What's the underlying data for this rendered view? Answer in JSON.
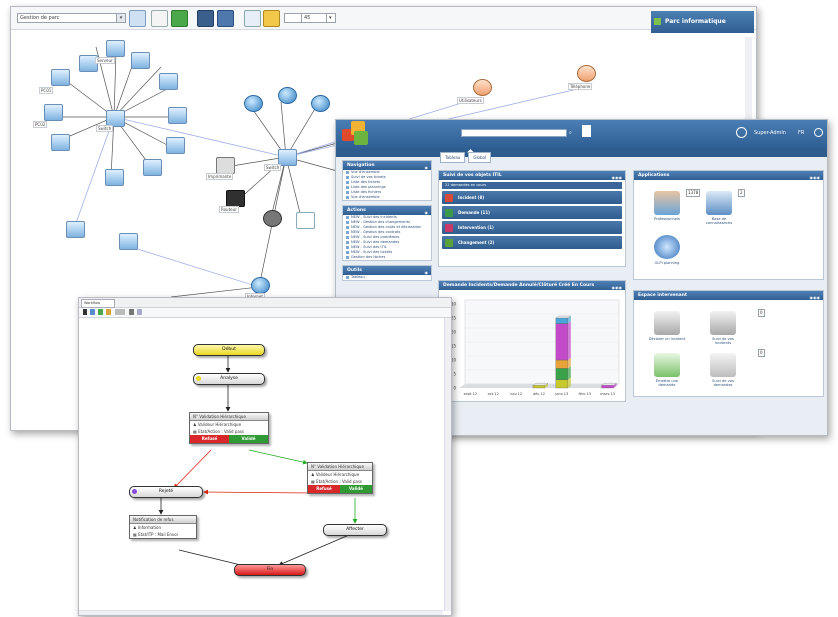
{
  "network": {
    "location_select": "Gestion de parc",
    "zoom_value": "45",
    "panel_title": "Parc informatique",
    "toolbar_icons": [
      "network-icon",
      "printer-icon",
      "plugin-icon",
      "save-icon",
      "save-as-icon",
      "export-icon",
      "tools-icon"
    ],
    "node_labels": [
      "PC01",
      "PC02",
      "Serveur",
      "Switch",
      "Imprimante",
      "Routeur",
      "Internet",
      "Téléphone",
      "Utilisateurs"
    ]
  },
  "glpi": {
    "header_user": "Super-Admin",
    "header_lang": "FR",
    "tabs": [
      "Tableau",
      "Global"
    ],
    "left": {
      "navigation_title": "Navigation",
      "navigation_items": [
        "Vue d'ensemble",
        "Suivi de vos tickets",
        "Liste des tickets",
        "Liste des plannings",
        "Liste des fichiers",
        "Vue d'ensemble"
      ],
      "actions_title": "Actions",
      "actions_items": [
        "NEW - Suivi des incidents",
        "NEW - Gestion des changements",
        "NEW - Gestion des coûts et déclaration",
        "NEW - Gestion des contrats",
        "NEW - Suivi des problèmes",
        "NEW - Suivi des demandes",
        "NEW - Suivi des ITIL",
        "NEW - Suivi des tickets",
        "Gestion des tâches"
      ],
      "third_title": "Outils",
      "third_items": [
        "Tableau"
      ]
    },
    "objects_panel": {
      "title": "Suivi de vos objets ITIL",
      "subtitle": "22 demandes en cours",
      "rows": [
        {
          "label": "Incident (8)",
          "color": "#d64a3a"
        },
        {
          "label": "Demande (11)",
          "color": "#3a9a4a"
        },
        {
          "label": "Intervention (1)",
          "color": "#c83a6a"
        },
        {
          "label": "Changement (2)",
          "color": "#5aa33a"
        }
      ]
    },
    "chart_panel": {
      "title": "Demande Incidents/Demande Annulé/Clôturé Créé En Cours"
    },
    "applications": {
      "title": "Applications",
      "items": [
        {
          "label": "Professionnels",
          "count": "1378"
        },
        {
          "label": "Base de connaissances",
          "count": "2"
        },
        {
          "label": "GLPI planning",
          "count": ""
        }
      ]
    },
    "espace": {
      "title": "Espace intervenant",
      "items": [
        {
          "label": "Déclarer un incident",
          "count": "0"
        },
        {
          "label": "Suivi de vos incidents",
          "count": "0"
        },
        {
          "label": "Émettre une demande",
          "count": ""
        },
        {
          "label": "Suivi de vos demandes",
          "count": "0"
        }
      ]
    }
  },
  "chart_data": {
    "type": "bar",
    "categories": [
      "sept.12",
      "oct.12",
      "nov.12",
      "déc.12",
      "janv.13",
      "févr.13",
      "mars.13"
    ],
    "series": [
      {
        "values": [
          0,
          0,
          0,
          1,
          3,
          0,
          0
        ],
        "color": "#c7c82e"
      },
      {
        "values": [
          0,
          0,
          0,
          0,
          4,
          0,
          0
        ],
        "color": "#3aa34a"
      },
      {
        "values": [
          0,
          0,
          0,
          0,
          3,
          0,
          0
        ],
        "color": "#e8a33a"
      },
      {
        "values": [
          0,
          0,
          0,
          0,
          13,
          0,
          1
        ],
        "color": "#c34ac8"
      },
      {
        "values": [
          0,
          0,
          0,
          0,
          2,
          0,
          0
        ],
        "color": "#4aa6d8"
      }
    ],
    "ylim": [
      0,
      30
    ],
    "yticks": [
      "0",
      "5",
      "10",
      "15",
      "20",
      "25",
      "30"
    ]
  },
  "workflow": {
    "tab": "Workflow",
    "start": "Début",
    "analyse": "Analyse",
    "validation1": {
      "title": "N° Validation Hiérarchique",
      "line1": "Valideur Hiérarchique",
      "line2": "Etat/Action : Valid pass",
      "refuse": "Refusé",
      "accept": "Validé"
    },
    "validation2": {
      "title": "N° Validation Hiérarchique",
      "line1": "Valideur Hiérarchique",
      "line2": "Etat/Action : Valid pass",
      "refuse": "Refusé",
      "accept": "Validé"
    },
    "refus": "Rejeté",
    "notif": {
      "title": "Notification de refus",
      "line1": "Information",
      "line2": "Etat/ITP : Mail Envoi"
    },
    "affecter": "Affecter",
    "end": "Fin"
  }
}
